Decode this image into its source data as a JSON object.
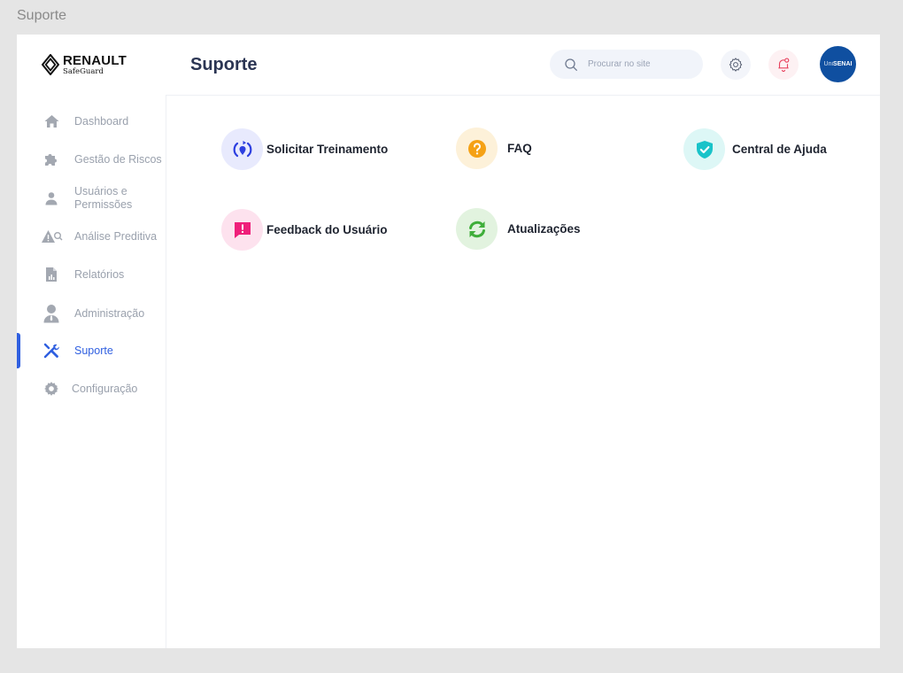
{
  "frame": {
    "label": "Suporte"
  },
  "logo": {
    "brand": "RENAULT",
    "sub": "SafeGuard"
  },
  "header": {
    "title": "Suporte",
    "search_placeholder": "Procurar no site",
    "avatar": {
      "prefix": "Uni",
      "name": "SENAI"
    }
  },
  "sidebar": {
    "items": [
      {
        "label": "Dashboard",
        "icon": "home-icon",
        "active": false
      },
      {
        "label": "Gestão de Riscos",
        "icon": "puzzle-icon",
        "active": false
      },
      {
        "label": "Usuários e Permissões",
        "icon": "user-icon",
        "active": false
      },
      {
        "label": "Análise Preditiva",
        "icon": "warning-search-icon",
        "active": false
      },
      {
        "label": "Relatórios",
        "icon": "report-icon",
        "active": false
      },
      {
        "label": "Administração",
        "icon": "admin-icon",
        "active": false
      },
      {
        "label": "Suporte",
        "icon": "tools-icon",
        "active": true
      },
      {
        "label": "Configuração",
        "icon": "gear-icon",
        "active": false
      }
    ]
  },
  "support": {
    "cards": [
      {
        "label": "Solicitar Treinamento",
        "icon": "training-icon",
        "color": "#2d3fe0",
        "bg": "#e8eafd"
      },
      {
        "label": "FAQ",
        "icon": "question-icon",
        "color": "#f5a115",
        "bg": "#fdf1d9"
      },
      {
        "label": "Central de Ajuda",
        "icon": "shield-check-icon",
        "color": "#19c3c9",
        "bg": "#ddf7f6"
      },
      {
        "label": "Feedback do Usuário",
        "icon": "feedback-icon",
        "color": "#ef1f7a",
        "bg": "#fde2ee"
      },
      {
        "label": "Atualizações",
        "icon": "refresh-icon",
        "color": "#3fae3a",
        "bg": "#e2f3df"
      }
    ]
  },
  "colors": {
    "accent": "#2f5fe0",
    "title": "#2b3553",
    "avatar_bg": "#0f4fa0"
  }
}
